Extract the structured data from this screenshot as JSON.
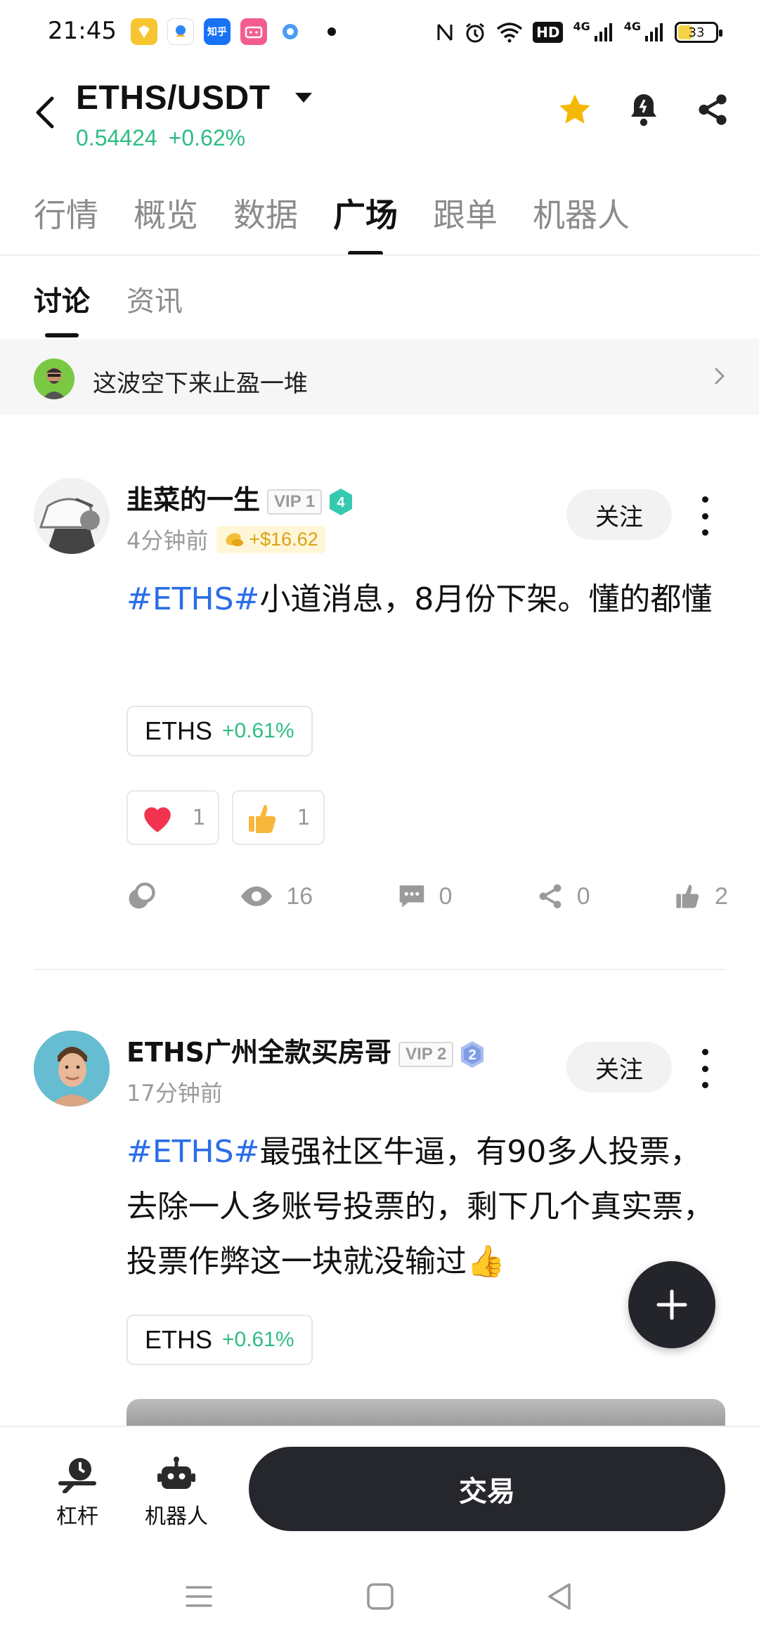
{
  "status_bar": {
    "time": "21:45",
    "app_icons": [
      "notification-app-icon",
      "qq-icon",
      "zhihu-icon",
      "bilibili-icon",
      "browser-icon"
    ],
    "zhihu_label": "知乎",
    "network_4g_1": "4G",
    "network_4g_2": "4G",
    "hd_label": "HD",
    "battery": "33"
  },
  "header": {
    "pair": "ETHS/USDT",
    "price": "0.54424",
    "change": "+0.62%",
    "colors": {
      "up": "#2ebd85",
      "star": "#f5b800"
    }
  },
  "main_tabs": [
    "行情",
    "概览",
    "数据",
    "广场",
    "跟单",
    "机器人"
  ],
  "active_main_tab": "广场",
  "sub_tabs": [
    "讨论",
    "资讯"
  ],
  "active_sub_tab": "讨论",
  "banner": {
    "text": "这波空下来止盈一堆"
  },
  "posts": [
    {
      "username": "韭菜的一生",
      "vip": "VIP 1",
      "level": "4",
      "time": "4分钟前",
      "earnings": "+$16.62",
      "follow_label": "关注",
      "hashtag": "#ETHS#",
      "content": "小道消息，8月份下架。懂的都懂",
      "coin": {
        "symbol": "ETHS",
        "change": "+0.61%"
      },
      "reactions": [
        {
          "emoji": "heart",
          "count": "1"
        },
        {
          "emoji": "thumbs-up",
          "count": "1"
        }
      ],
      "stats": {
        "views": "16",
        "comments": "0",
        "shares": "0",
        "likes": "2"
      }
    },
    {
      "username": "ETHS广州全款买房哥",
      "vip": "VIP 2",
      "level": "2",
      "time": "17分钟前",
      "follow_label": "关注",
      "hashtag": "#ETHS#",
      "content": "最强社区牛逼，有90多人投票，去除一人多账号投票的，剩下几个真实票，投票作弊这一块就没输过👍",
      "coin": {
        "symbol": "ETHS",
        "change": "+0.61%"
      }
    }
  ],
  "bottom_bar": {
    "leverage_label": "杠杆",
    "robot_label": "机器人",
    "trade_label": "交易"
  }
}
